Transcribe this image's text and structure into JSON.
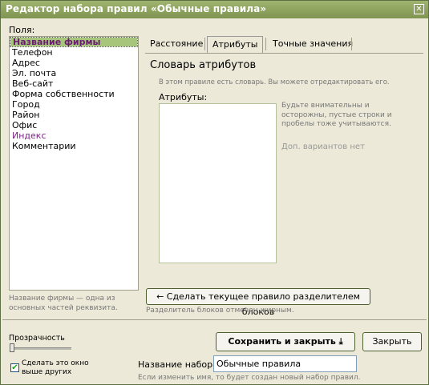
{
  "window": {
    "title": "Редактор набора правил «Обычные правила»",
    "close_glyph": "✕"
  },
  "fields": {
    "label": "Поля:",
    "items": [
      "Название фирмы",
      "Телефон",
      "Адрес",
      "Эл. почта",
      "Веб-сайт",
      "Форма собственности",
      "Город",
      "Район",
      "Офис",
      "Индекс",
      "Комментарии"
    ],
    "selected_index": 0,
    "hint": "Название фирмы — одна из основных частей реквизита."
  },
  "tabs": {
    "items": [
      "Расстояние",
      "Атрибуты",
      "Точные значения"
    ],
    "active_index": 1
  },
  "attributes_panel": {
    "title": "Словарь атрибутов",
    "note": "В этом правиле есть словарь. Вы можете отредактировать его.",
    "attrs_label": "Атрибуты:",
    "warning": "Будьте внимательны и осторожны, пустые строки и пробелы тоже учитываются.",
    "no_variants": "Доп. вариантов нет"
  },
  "split": {
    "button_label": "← Сделать текущее правило разделителем блоков",
    "note": "Разделитель блоков отмечен жирным."
  },
  "bottom": {
    "opacity_label": "Прозрачность",
    "opacity_value": 0,
    "on_top_checked": true,
    "on_top_label": "Сделать это окно выше других",
    "save_label": "Сохранить и закрыть ⤓",
    "close_label": "Закрыть",
    "set_name_label": "Название набора:",
    "set_name_value": "Обычные правила",
    "set_name_note": "Если изменить имя, то будет создан новый набор правил."
  },
  "colors": {
    "titlebar": "#8ea45e",
    "selection": "#a7c67c",
    "accent_text": "#7a2182"
  }
}
